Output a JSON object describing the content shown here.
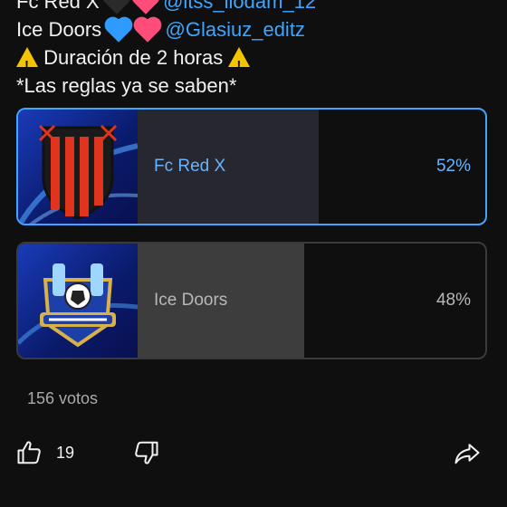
{
  "post": {
    "line1_prefix": "Fc Red X",
    "line1_handle": "@itss_liodam_12",
    "line2_prefix": "Ice Doors",
    "line2_handle": "@Glasiuz_editz",
    "line3_text": "Duración de 2 horas",
    "line4_text": "*Las reglas ya se saben*",
    "heart_colors": {
      "black": "#2a2a2a",
      "blue": "#2f9bff",
      "pink": "#ff4d7a"
    }
  },
  "poll": {
    "options": [
      {
        "label": "Fc Red X",
        "percent_label": "52%",
        "percent": 52,
        "selected": true
      },
      {
        "label": "Ice Doors",
        "percent_label": "48%",
        "percent": 48,
        "selected": false
      }
    ],
    "votes_label": "156 votos"
  },
  "actions": {
    "like_count": "19",
    "like_icon": "thumbs-up-icon",
    "dislike_icon": "thumbs-down-icon",
    "share_icon": "share-icon"
  },
  "colors": {
    "accent": "#3ea6ff",
    "background": "#0f0f0f"
  }
}
